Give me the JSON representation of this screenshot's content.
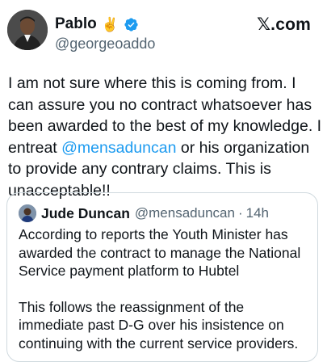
{
  "author": {
    "name": "Pablo",
    "emoji": "✌️",
    "handle": "@georgeoaddo"
  },
  "brand": "𝕏.com",
  "tweet": {
    "text_before": "I am not sure where this is coming from. I can assure you no contract whatsoever has been awarded to the best of my knowledge. I entreat ",
    "mention": "@mensaduncan",
    "text_after": " or his organization to provide any contrary claims. This is unacceptable!!"
  },
  "quoted": {
    "name": "Jude Duncan",
    "handle": "@mensaduncan",
    "separator": "·",
    "time": "14h",
    "paragraph1": "According to reports the Youth Minister has awarded the contract to manage the National Service payment platform to Hubtel",
    "paragraph2": "This follows the reassignment of the immediate past D-G over his insistence on continuing with the current service providers."
  },
  "colors": {
    "verified": "#1d9bf0",
    "mention": "#1d9bf0",
    "secondary_text": "#536471"
  },
  "icons": {
    "verified": "verified-badge-icon",
    "avatar": "profile-photo",
    "quoted_avatar": "profile-photo"
  }
}
